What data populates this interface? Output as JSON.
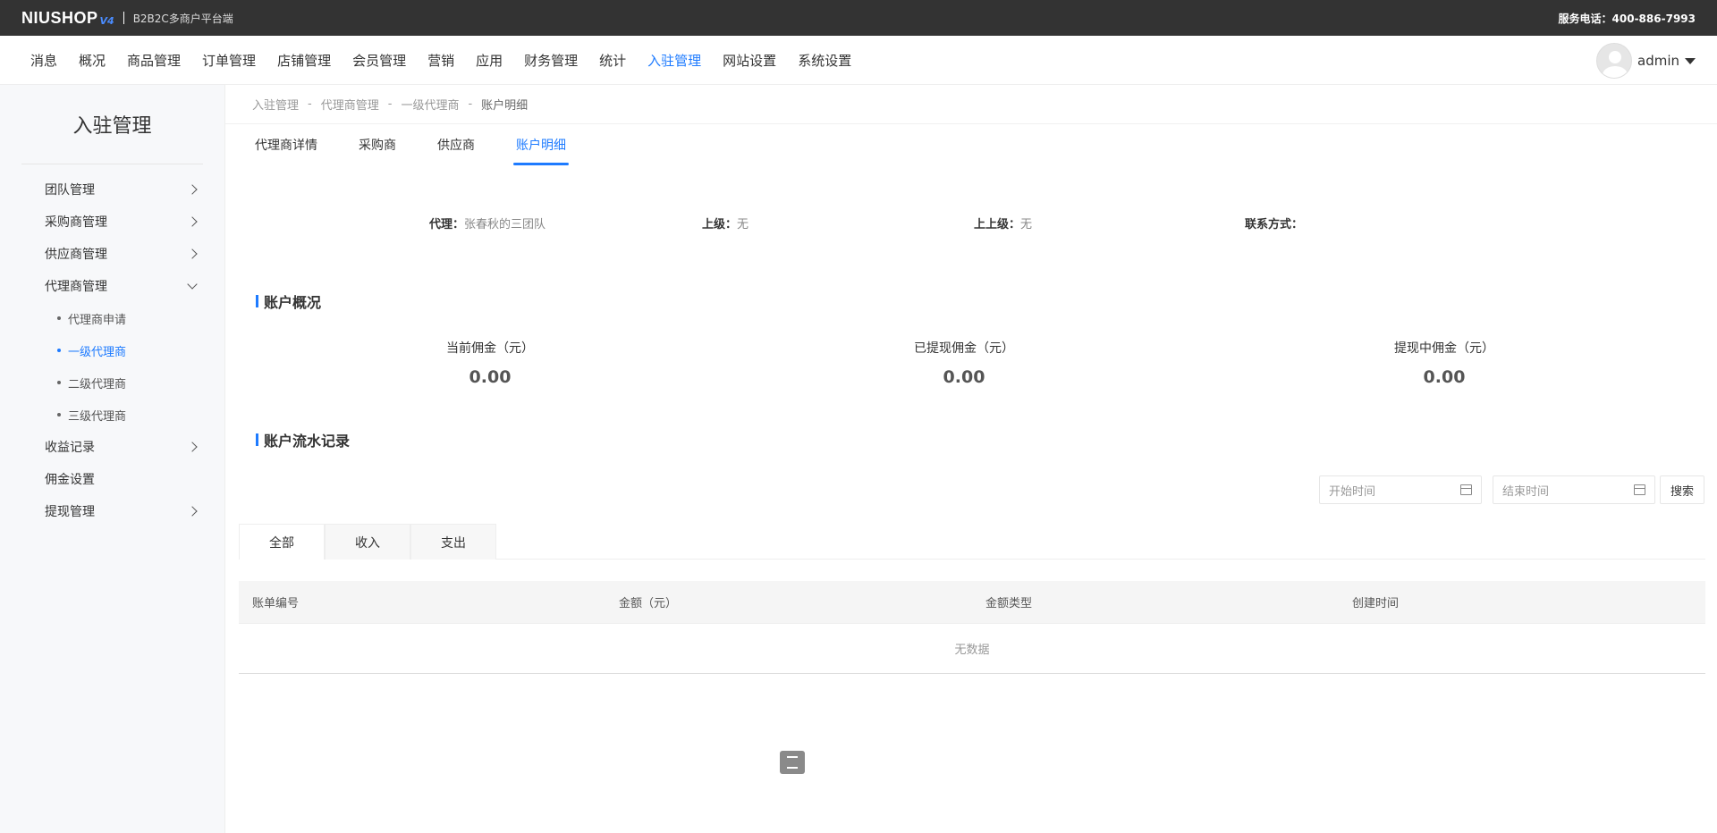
{
  "topbar": {
    "logo": "NIUSHOP",
    "version": "V4",
    "subtitle": "B2B2C多商户平台端",
    "service": "服务电话：400-886-7993"
  },
  "nav": {
    "items": [
      "消息",
      "概况",
      "商品管理",
      "订单管理",
      "店铺管理",
      "会员管理",
      "营销",
      "应用",
      "财务管理",
      "统计",
      "入驻管理",
      "网站设置",
      "系统设置"
    ],
    "active": "入驻管理",
    "user": "admin"
  },
  "sidebar": {
    "title": "入驻管理",
    "items": [
      {
        "label": "团队管理"
      },
      {
        "label": "采购商管理"
      },
      {
        "label": "供应商管理"
      },
      {
        "label": "代理商管理"
      },
      {
        "label": "代理商申请"
      },
      {
        "label": "一级代理商"
      },
      {
        "label": "二级代理商"
      },
      {
        "label": "三级代理商"
      },
      {
        "label": "收益记录"
      },
      {
        "label": "佣金设置"
      },
      {
        "label": "提现管理"
      }
    ]
  },
  "breadcrumb": [
    "入驻管理",
    "代理商管理",
    "一级代理商",
    "账户明细"
  ],
  "tabs": [
    "代理商详情",
    "采购商",
    "供应商",
    "账户明细"
  ],
  "info": {
    "agent_label": "代理：",
    "agent_value": "张春秋的三团队",
    "parent_label": "上级：",
    "parent_value": "无",
    "grandparent_label": "上上级：",
    "grandparent_value": "无",
    "contact_label": "联系方式："
  },
  "overview": {
    "title": "账户概况",
    "stats": [
      {
        "label": "当前佣金（元）",
        "value": "0.00"
      },
      {
        "label": "已提现佣金（元）",
        "value": "0.00"
      },
      {
        "label": "提现中佣金（元）",
        "value": "0.00"
      }
    ]
  },
  "records": {
    "title": "账户流水记录",
    "start_placeholder": "开始时间",
    "end_placeholder": "结束时间",
    "search_label": "搜索",
    "sub_tabs": [
      "全部",
      "收入",
      "支出"
    ],
    "columns": [
      "账单编号",
      "金额（元）",
      "金额类型",
      "创建时间"
    ],
    "empty": "无数据"
  },
  "colors": {
    "accent": "#1e7bff",
    "topbar": "#333333"
  }
}
